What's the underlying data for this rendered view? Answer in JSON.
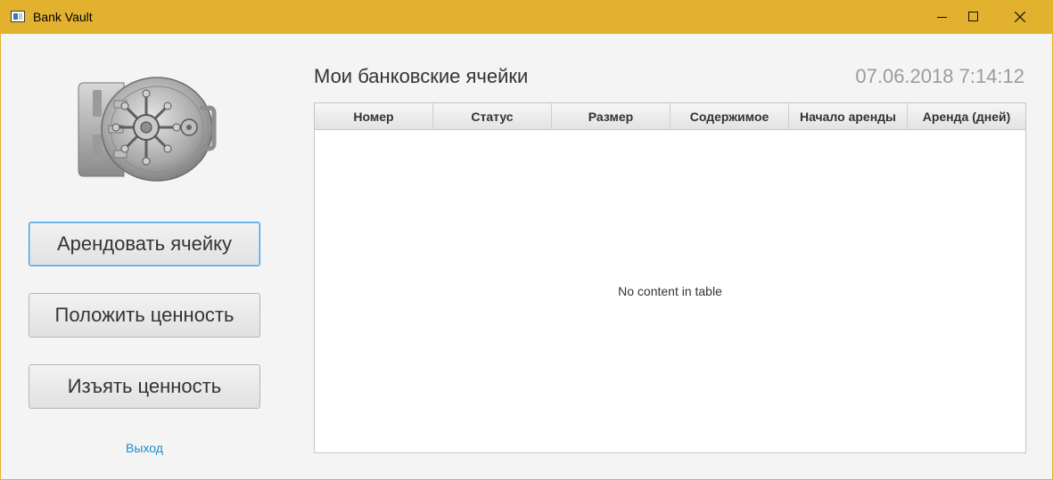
{
  "window": {
    "title": "Bank Vault"
  },
  "sidebar": {
    "buttons": [
      {
        "label": "Арендовать ячейку"
      },
      {
        "label": "Положить ценность"
      },
      {
        "label": "Изъять ценность"
      }
    ],
    "exit_label": "Выход"
  },
  "main": {
    "title": "Мои банковские ячейки",
    "datetime": "07.06.2018 7:14:12",
    "table": {
      "columns": [
        "Номер",
        "Статус",
        "Размер",
        "Содержимое",
        "Начало аренды",
        "Аренда (дней)"
      ],
      "rows": [],
      "empty_message": "No content in table"
    }
  },
  "colors": {
    "titlebar": "#e2b22f",
    "link": "#1f8ad0",
    "focus": "#3c98d8"
  },
  "icons": {
    "app": "window-app-icon",
    "logo": "bank-vault-door-icon"
  }
}
